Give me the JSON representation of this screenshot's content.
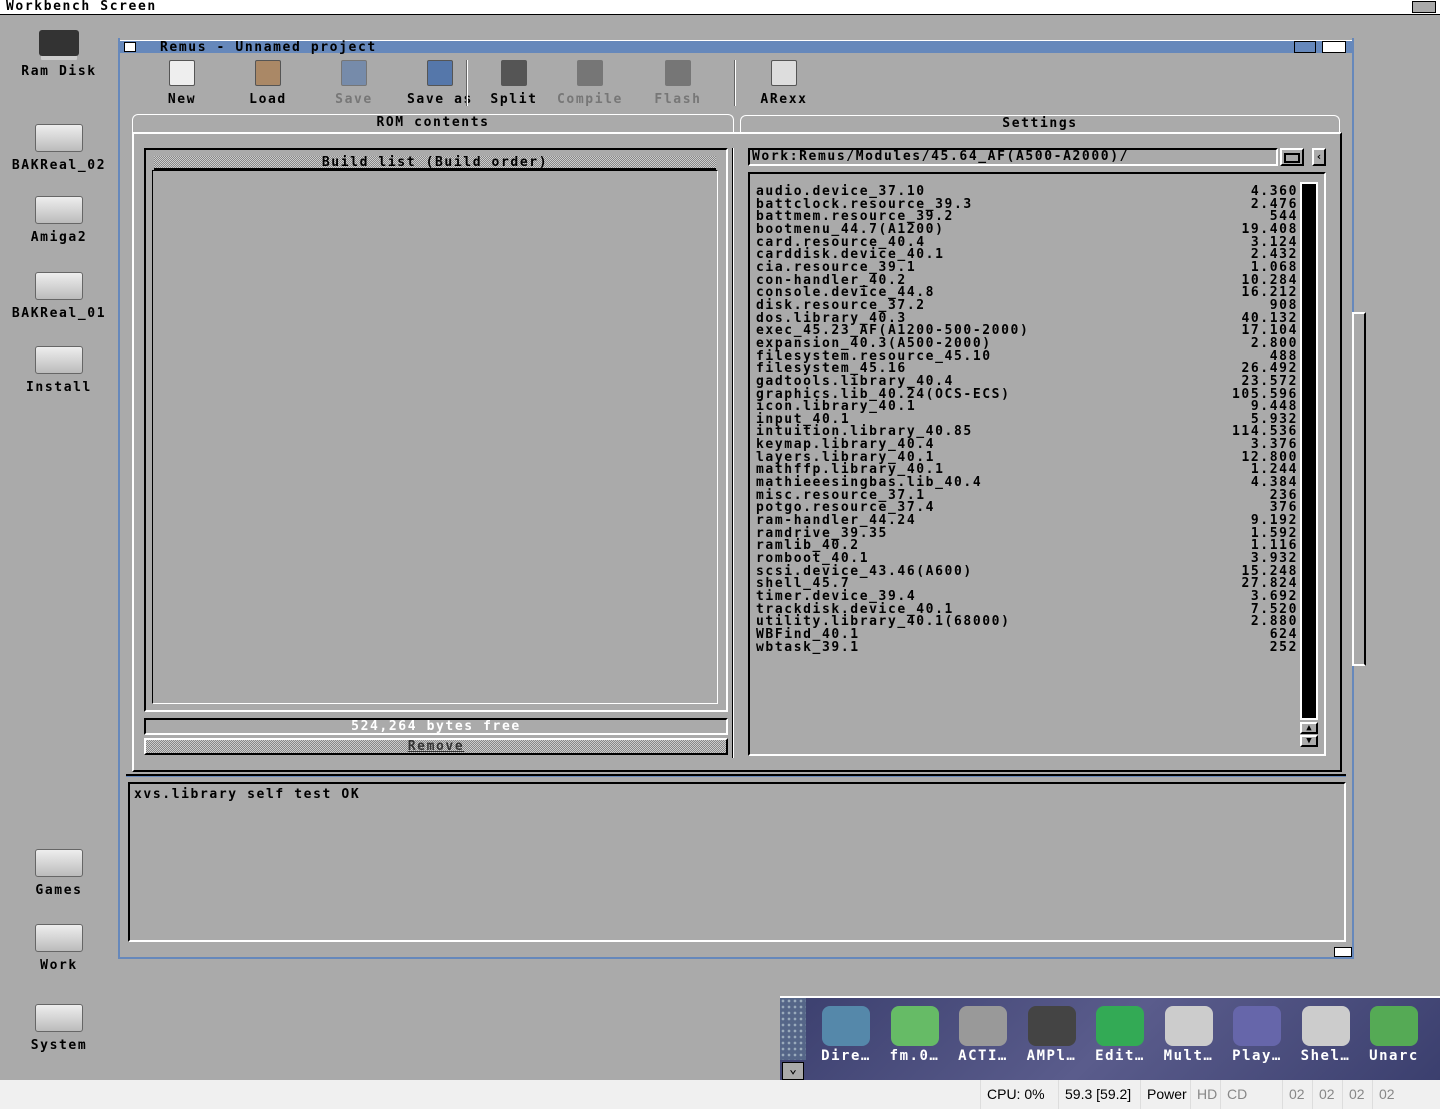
{
  "screen": {
    "title": "Workbench Screen"
  },
  "desktop_icons": [
    {
      "label": "Ram Disk",
      "type": "chip"
    },
    {
      "label": "BAKReal_02",
      "type": "drive"
    },
    {
      "label": "Amiga2",
      "type": "drive"
    },
    {
      "label": "BAKReal_01",
      "type": "drive"
    },
    {
      "label": "Install",
      "type": "drive"
    },
    {
      "label": "Games",
      "type": "drive"
    },
    {
      "label": "Work",
      "type": "drive"
    },
    {
      "label": "System",
      "type": "drive"
    }
  ],
  "window": {
    "title": "Remus - Unnamed project"
  },
  "toolbar": [
    {
      "label": "New",
      "enabled": true,
      "icon": "new-document-icon"
    },
    {
      "label": "Load",
      "enabled": true,
      "icon": "folder-icon"
    },
    {
      "label": "Save",
      "enabled": false,
      "icon": "floppy-icon"
    },
    {
      "label": "Save as",
      "enabled": true,
      "icon": "floppy-icon"
    },
    {
      "label": "Split",
      "enabled": true,
      "icon": "chip-icon"
    },
    {
      "label": "Compile",
      "enabled": false,
      "icon": "chip-icon"
    },
    {
      "label": "Flash",
      "enabled": false,
      "icon": "chip-icon"
    },
    {
      "label": "ARexx",
      "enabled": true,
      "icon": "arexx-icon"
    }
  ],
  "tabs": [
    {
      "label": "ROM contents",
      "active": true
    },
    {
      "label": "Settings",
      "active": false
    }
  ],
  "build_list": {
    "header": "Build list (Build order)",
    "items": [],
    "bytes_free": "524,264 bytes free",
    "remove_label": "Remove"
  },
  "module_browser": {
    "path": "Work:Remus/Modules/45.64_AF(A500-A2000)/",
    "items": [
      [
        "audio.device_37.10",
        "4.360"
      ],
      [
        "battclock.resource_39.3",
        "2.476"
      ],
      [
        "battmem.resource_39.2",
        "544"
      ],
      [
        "bootmenu_44.7(A1200)",
        "19.408"
      ],
      [
        "card.resource_40.4",
        "3.124"
      ],
      [
        "carddisk.device_40.1",
        "2.432"
      ],
      [
        "cia.resource_39.1",
        "1.068"
      ],
      [
        "con-handler_40.2",
        "10.284"
      ],
      [
        "console.device_44.8",
        "16.212"
      ],
      [
        "disk.resource_37.2",
        "908"
      ],
      [
        "dos.library_40.3",
        "40.132"
      ],
      [
        "exec_45.23_AF(A1200-500-2000)",
        "17.104"
      ],
      [
        "expansion_40.3(A500-2000)",
        "2.800"
      ],
      [
        "filesystem.resource_45.10",
        "488"
      ],
      [
        "filesystem_45.16",
        "26.492"
      ],
      [
        "gadtools.library_40.4",
        "23.572"
      ],
      [
        "graphics.lib_40.24(OCS-ECS)",
        "105.596"
      ],
      [
        "icon.library_40.1",
        "9.448"
      ],
      [
        "input_40.1",
        "5.932"
      ],
      [
        "intuition.library_40.85",
        "114.536"
      ],
      [
        "keymap.library_40.4",
        "3.376"
      ],
      [
        "layers.library_40.1",
        "12.800"
      ],
      [
        "mathffp.library_40.1",
        "1.244"
      ],
      [
        "mathieeesingbas.lib_40.4",
        "4.384"
      ],
      [
        "misc.resource_37.1",
        "236"
      ],
      [
        "potgo.resource_37.4",
        "376"
      ],
      [
        "ram-handler_44.24",
        "9.192"
      ],
      [
        "ramdrive_39.35",
        "1.592"
      ],
      [
        "ramlib_40.2",
        "1.116"
      ],
      [
        "romboot_40.1",
        "3.932"
      ],
      [
        "scsi.device_43.46(A600)",
        "15.248"
      ],
      [
        "shell_45.7",
        "27.824"
      ],
      [
        "timer.device_39.4",
        "3.692"
      ],
      [
        "trackdisk.device_40.1",
        "7.520"
      ],
      [
        "utility.library_40.1(68000)",
        "2.880"
      ],
      [
        "WBFind_40.1",
        "624"
      ],
      [
        "wbtask_39.1",
        "252"
      ]
    ]
  },
  "log": {
    "text": "xvs.library self test OK"
  },
  "dock": [
    {
      "label": "Dire…"
    },
    {
      "label": "fm.0…"
    },
    {
      "label": "ACTI…"
    },
    {
      "label": "AMPl…"
    },
    {
      "label": "Edit…"
    },
    {
      "label": "Mult…"
    },
    {
      "label": "Play…"
    },
    {
      "label": "Shel…"
    },
    {
      "label": "Unarc"
    }
  ],
  "status": {
    "cpu": "CPU: 0%",
    "fps": "59.3 [59.2]",
    "power": "Power",
    "hd": "HD",
    "cd": "CD",
    "drives": [
      "02",
      "02",
      "02",
      "02"
    ]
  },
  "colors": {
    "background": "#aaaaaa",
    "title_bar": "#6688bb",
    "dock": "#4a4c7c"
  }
}
